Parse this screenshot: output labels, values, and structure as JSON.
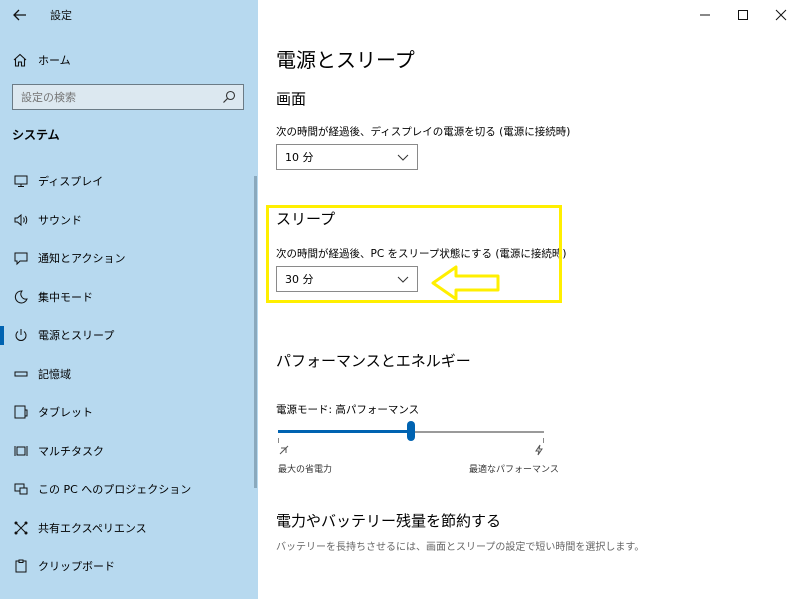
{
  "window": {
    "title": "設定"
  },
  "sidebar": {
    "home_label": "ホーム",
    "search_placeholder": "設定の検索",
    "section": "システム",
    "items": [
      {
        "label": "ディスプレイ",
        "icon": "monitor-icon"
      },
      {
        "label": "サウンド",
        "icon": "speaker-icon"
      },
      {
        "label": "通知とアクション",
        "icon": "notification-icon"
      },
      {
        "label": "集中モード",
        "icon": "moon-icon"
      },
      {
        "label": "電源とスリープ",
        "icon": "power-icon",
        "active": true
      },
      {
        "label": "記憶域",
        "icon": "storage-icon"
      },
      {
        "label": "タブレット",
        "icon": "tablet-icon"
      },
      {
        "label": "マルチタスク",
        "icon": "multitask-icon"
      },
      {
        "label": "この PC へのプロジェクション",
        "icon": "projection-icon"
      },
      {
        "label": "共有エクスペリエンス",
        "icon": "shared-icon"
      },
      {
        "label": "クリップボード",
        "icon": "clipboard-icon"
      }
    ]
  },
  "main": {
    "title": "電源とスリープ",
    "screen": {
      "heading": "画面",
      "desc": "次の時間が経過後、ディスプレイの電源を切る (電源に接続時)",
      "value": "10 分"
    },
    "sleep": {
      "heading": "スリープ",
      "desc": "次の時間が経過後、PC をスリープ状態にする (電源に接続時)",
      "value": "30 分"
    },
    "performance": {
      "heading": "パフォーマンスとエネルギー",
      "mode_label": "電源モード: 高パフォーマンス",
      "slider_fraction": 0.5,
      "left_label": "最大の省電力",
      "right_label": "最適なパフォーマンス"
    },
    "battery": {
      "heading": "電力やバッテリー残量を節約する",
      "desc": "バッテリーを長持ちさせるには、画面とスリープの設定で短い時間を選択します。"
    }
  },
  "colors": {
    "sidebar_bg": "#b7d9ef",
    "accent": "#0063b1",
    "highlight": "#ffef00"
  }
}
